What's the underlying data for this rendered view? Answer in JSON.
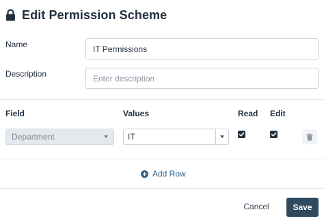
{
  "dialog": {
    "title": "Edit Permission Scheme",
    "icon": "lock-icon"
  },
  "form": {
    "name_label": "Name",
    "name_value": "IT Permissions",
    "description_label": "Description",
    "description_placeholder": "Enter description"
  },
  "table": {
    "headers": {
      "field": "Field",
      "values": "Values",
      "read": "Read",
      "edit": "Edit"
    },
    "rows": [
      {
        "field": "Department",
        "value": "IT",
        "read": true,
        "edit": true
      }
    ]
  },
  "actions": {
    "add_row": "Add Row",
    "cancel": "Cancel",
    "save": "Save"
  },
  "colors": {
    "primary": "#2f4a5f",
    "link": "#2f5f86",
    "checkbox": "#24303d"
  }
}
